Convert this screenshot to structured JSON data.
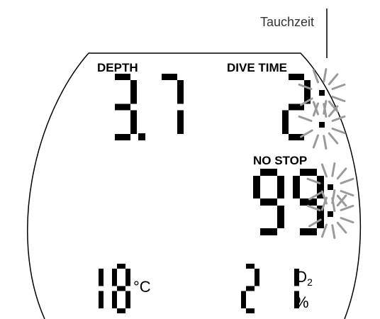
{
  "annotation": {
    "label": "Tauchzeit"
  },
  "display": {
    "depth_label": "DEPTH",
    "depth_value": "3.7",
    "dive_time_label": "DIVE TIME",
    "dive_time_value": "2",
    "no_stop_label": "NO STOP",
    "no_stop_value": "99",
    "temperature_value": "18",
    "temperature_unit": "°C",
    "o2_value": "21",
    "o2_label": "O2",
    "o2_unit": "%"
  },
  "colors": {
    "segment": "#000000",
    "blink_rays": "#9a9a9a",
    "outline": "#000000"
  }
}
